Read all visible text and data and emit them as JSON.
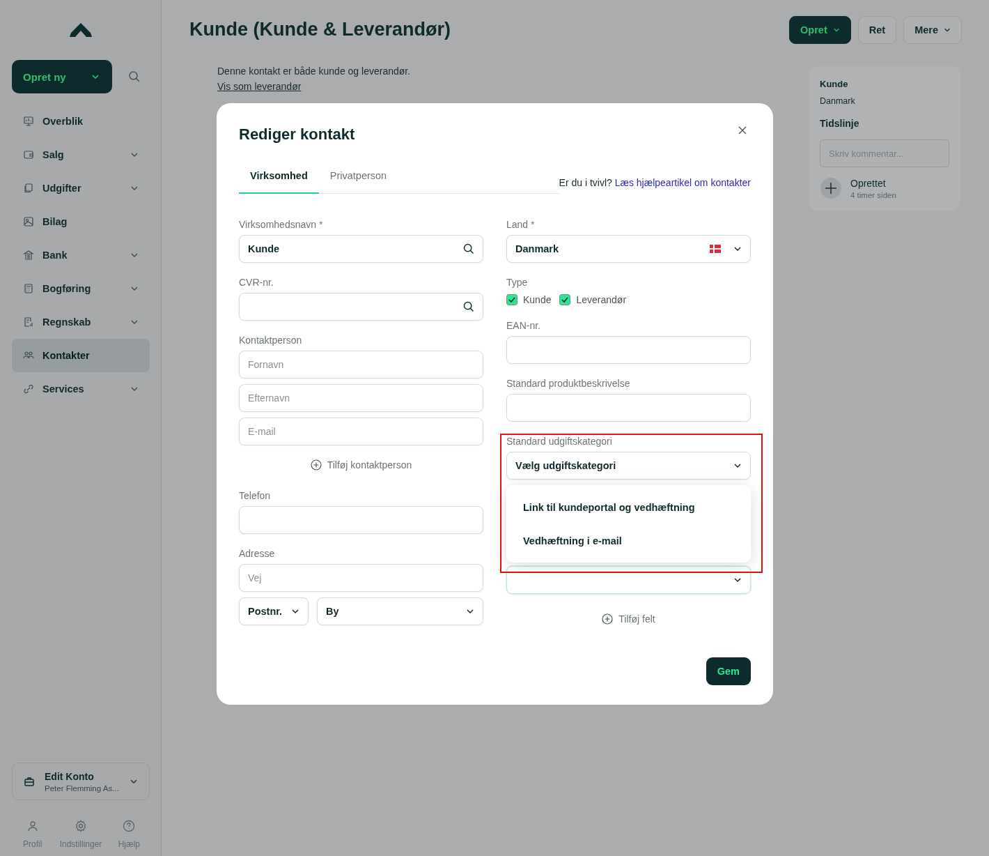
{
  "sidebar": {
    "create_button": "Opret ny",
    "nav": [
      {
        "label": "Overblik",
        "expandable": false,
        "selected": false
      },
      {
        "label": "Salg",
        "expandable": true,
        "selected": false
      },
      {
        "label": "Udgifter",
        "expandable": true,
        "selected": false
      },
      {
        "label": "Bilag",
        "expandable": false,
        "selected": false
      },
      {
        "label": "Bank",
        "expandable": true,
        "selected": false
      },
      {
        "label": "Bogføring",
        "expandable": true,
        "selected": false
      },
      {
        "label": "Regnskab",
        "expandable": true,
        "selected": false
      },
      {
        "label": "Kontakter",
        "expandable": false,
        "selected": true
      },
      {
        "label": "Services",
        "expandable": true,
        "selected": false
      }
    ],
    "account": {
      "name": "Edit Konto",
      "subtitle": "Peter Flemming As..."
    },
    "footer": [
      "Profil",
      "Indstillinger",
      "Hjælp"
    ]
  },
  "page": {
    "title": "Kunde (Kunde & Leverandør)",
    "actions": [
      {
        "label": "Opret",
        "kind": "primary",
        "dropdown": true
      },
      {
        "label": "Ret",
        "kind": "secondary",
        "dropdown": false
      },
      {
        "label": "Mere",
        "kind": "secondary",
        "dropdown": true
      }
    ],
    "notice": "Denne kontakt er både kunde og leverandør.",
    "notice_link": "Vis som leverandør"
  },
  "side_panel": {
    "type": "Kunde",
    "country": "Danmark",
    "timeline_title": "Tidslinje",
    "comment_placeholder": "Skriv kommentar...",
    "events": [
      {
        "title": "Oprettet",
        "time": "4 timer siden"
      }
    ]
  },
  "modal": {
    "title": "Rediger kontakt",
    "tabs": [
      {
        "label": "Virksomhed",
        "selected": true
      },
      {
        "label": "Privatperson",
        "selected": false
      }
    ],
    "help_text": "Er du i tvivl?",
    "help_link": "Læs hjælpeartikel om kontakter",
    "company_name": {
      "label": "Virksomhedsnavn *",
      "value": "Kunde"
    },
    "cvr": {
      "label": "CVR-nr."
    },
    "contact_person": {
      "label": "Kontaktperson",
      "fields": [
        {
          "placeholder": "Fornavn"
        },
        {
          "placeholder": "Efternavn"
        },
        {
          "placeholder": "E-mail"
        }
      ],
      "add": "Tilføj kontaktperson"
    },
    "phone": {
      "label": "Telefon"
    },
    "address": {
      "label": "Adresse",
      "street_placeholder": "Vej",
      "postcode": "Postnr.",
      "city": "By"
    },
    "country": {
      "label": "Land *",
      "value": "Danmark"
    },
    "type": {
      "label": "Type",
      "options": [
        {
          "label": "Kunde",
          "checked": true
        },
        {
          "label": "Leverandør",
          "checked": true
        }
      ]
    },
    "ean": {
      "label": "EAN-nr."
    },
    "product_description": {
      "label": "Standard produktbeskrivelse"
    },
    "expense_category": {
      "label": "Standard udgiftskategori",
      "value": "Vælg udgiftskategori",
      "expanded": true,
      "options": [
        {
          "label": "Link til kundeportal og vedhæftning"
        },
        {
          "label": "Vedhæftning i e-mail"
        }
      ]
    },
    "add_field": "Tilføj felt",
    "save": "Gem"
  }
}
